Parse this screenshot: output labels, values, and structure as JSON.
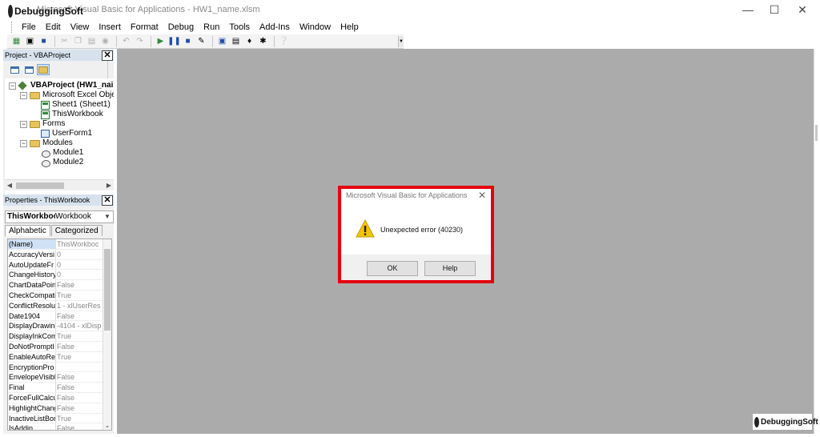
{
  "window": {
    "title": "Microsoft Visual Basic for Applications - HW1_name.xlsm",
    "minimize": "—",
    "maximize": "☐",
    "close": "✕"
  },
  "logo": {
    "text": "DebuggingSoft"
  },
  "menu": [
    "File",
    "Edit",
    "View",
    "Insert",
    "Format",
    "Debug",
    "Run",
    "Tools",
    "Add-Ins",
    "Window",
    "Help"
  ],
  "toolbar": {
    "icons": [
      "excel-view-icon",
      "insert-userform-icon",
      "save-icon",
      "cut-icon",
      "copy-icon",
      "paste-icon",
      "find-icon",
      "undo-icon",
      "redo-icon",
      "run-icon",
      "break-icon",
      "reset-icon",
      "design-mode-icon",
      "project-explorer-icon",
      "properties-window-icon",
      "object-browser-icon",
      "toolbox-icon",
      "help-icon"
    ]
  },
  "project_panel": {
    "title": "Project - VBAProject",
    "close": "✕",
    "tree": [
      {
        "label": "VBAProject (HW1_nai",
        "level": 0,
        "expander": "−",
        "icon": "project-icon",
        "bold": true
      },
      {
        "label": "Microsoft Excel Objec",
        "level": 1,
        "expander": "−",
        "icon": "folder-icon"
      },
      {
        "label": "Sheet1 (Sheet1)",
        "level": 2,
        "icon": "sheet-icon"
      },
      {
        "label": "ThisWorkbook",
        "level": 2,
        "icon": "workbook-icon"
      },
      {
        "label": "Forms",
        "level": 1,
        "expander": "−",
        "icon": "folder-icon"
      },
      {
        "label": "UserForm1",
        "level": 2,
        "icon": "form-icon"
      },
      {
        "label": "Modules",
        "level": 1,
        "expander": "−",
        "icon": "folder-icon"
      },
      {
        "label": "Module1",
        "level": 2,
        "icon": "module-icon"
      },
      {
        "label": "Module2",
        "level": 2,
        "icon": "module-icon"
      }
    ]
  },
  "properties_panel": {
    "title": "Properties - ThisWorkbook",
    "close": "✕",
    "object_name": "ThisWorkboc",
    "object_type": "Workbook",
    "tabs": [
      "Alphabetic",
      "Categorized"
    ],
    "rows": [
      {
        "name": "(Name)",
        "value": "ThisWorkboc"
      },
      {
        "name": "AccuracyVersi",
        "value": "0"
      },
      {
        "name": "AutoUpdateFr",
        "value": "0"
      },
      {
        "name": "ChangeHistory",
        "value": "0"
      },
      {
        "name": "ChartDataPoin",
        "value": "False"
      },
      {
        "name": "CheckCompati",
        "value": "True"
      },
      {
        "name": "ConflictResolu",
        "value": "1 - xlUserRes"
      },
      {
        "name": "Date1904",
        "value": "False"
      },
      {
        "name": "DisplayDrawing",
        "value": "-4104 - xlDisp"
      },
      {
        "name": "DisplayInkCom",
        "value": "True"
      },
      {
        "name": "DoNotPromptI",
        "value": "False"
      },
      {
        "name": "EnableAutoRe",
        "value": "True"
      },
      {
        "name": "EncryptionPro",
        "value": ""
      },
      {
        "name": "EnvelopeVisibl",
        "value": "False"
      },
      {
        "name": "Final",
        "value": "False"
      },
      {
        "name": "ForceFullCalcul",
        "value": "False"
      },
      {
        "name": "HighlightChang",
        "value": "False"
      },
      {
        "name": "InactiveListBor",
        "value": "True"
      },
      {
        "name": "IsAddin",
        "value": "False"
      }
    ]
  },
  "dialog": {
    "title": "Microsoft Visual Basic for Applications",
    "close": "✕",
    "message": "Unexpected error (40230)",
    "ok_label": "OK",
    "help_label": "Help"
  },
  "watermark": {
    "text": "DebuggingSoft"
  },
  "colors": {
    "highlight": "#e3000f",
    "workspace": "#ababab",
    "panel_title": "#d7e2ee"
  }
}
